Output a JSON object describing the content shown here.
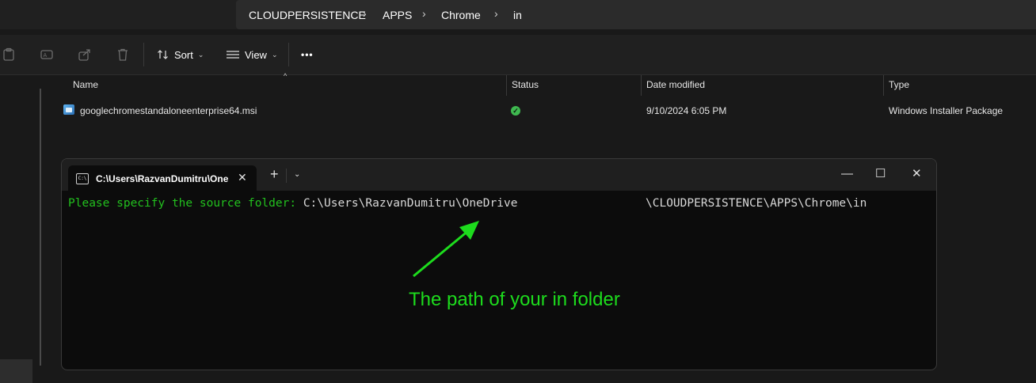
{
  "breadcrumb": [
    "CLOUDPERSISTENCE",
    "APPS",
    "Chrome",
    "in"
  ],
  "commandbar": {
    "sort_label": "Sort",
    "view_label": "View",
    "more_label": "•••"
  },
  "columns": {
    "name": "Name",
    "status": "Status",
    "date_modified": "Date modified",
    "type": "Type"
  },
  "files": [
    {
      "name": "googlechromestandaloneenterprise64.msi",
      "status": "synced",
      "date_modified": "9/10/2024 6:05 PM",
      "type": "Windows Installer Package"
    }
  ],
  "terminal": {
    "tab_title": "C:\\Users\\RazvanDumitru\\One",
    "tab_icon_text": "C:\\",
    "prompt": "Please specify the source folder: ",
    "path_part1": "C:\\Users\\RazvanDumitru\\OneDrive",
    "path_part2": "\\CLOUDPERSISTENCE\\APPS\\Chrome\\in",
    "annotation": "The path of your in folder",
    "annotation_color": "#1ddc1d",
    "prompt_color": "#22c01e"
  }
}
